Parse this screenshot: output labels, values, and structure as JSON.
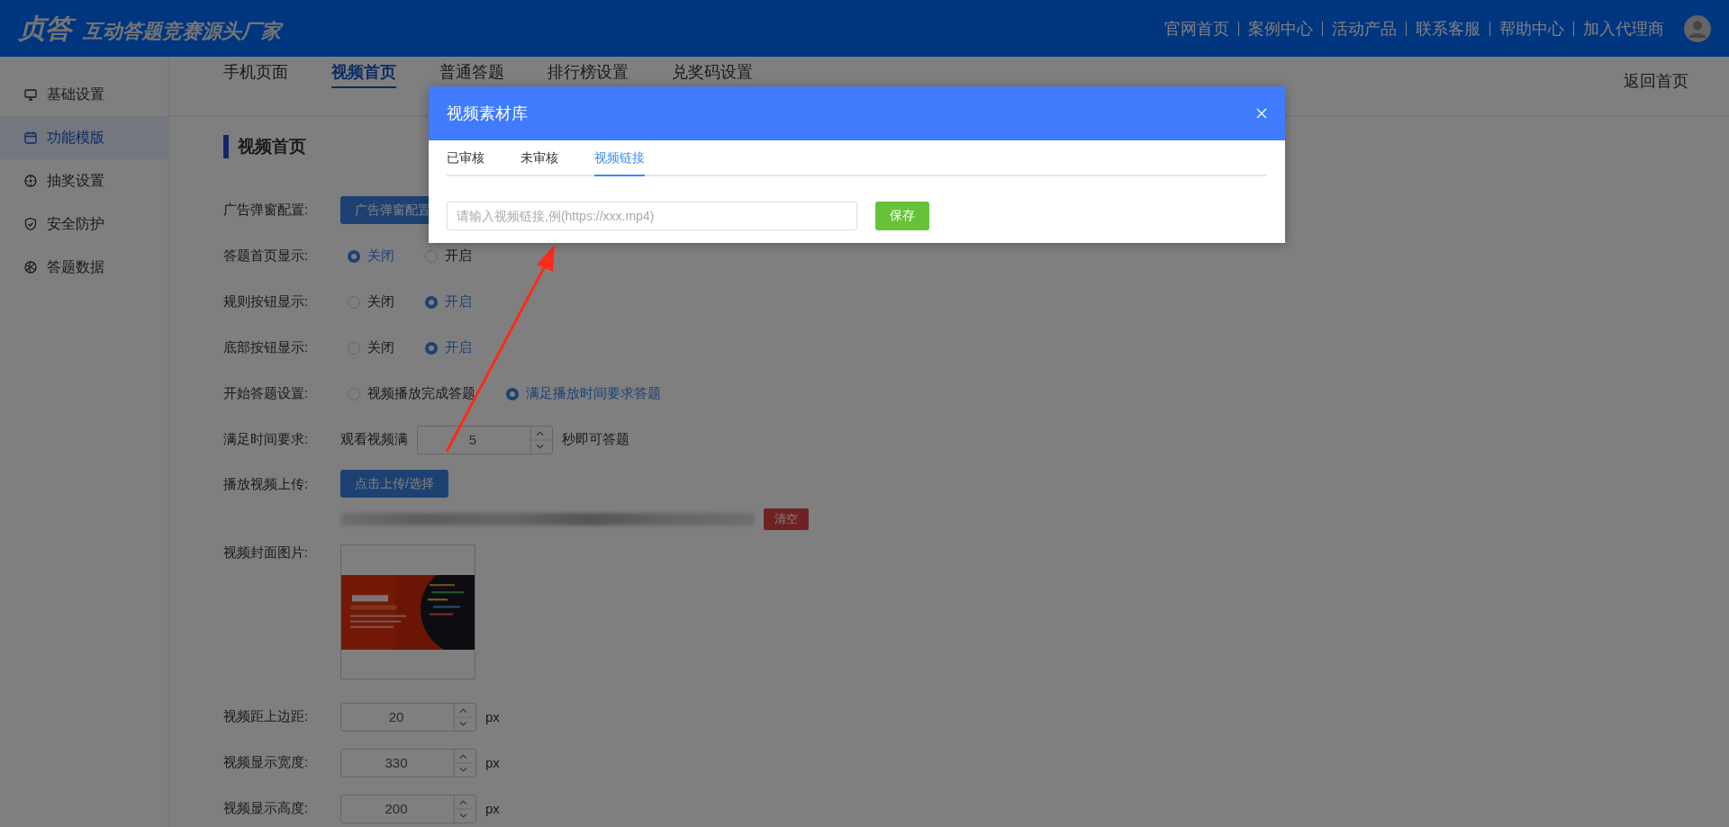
{
  "header": {
    "logo_mark": "贞答",
    "slogan": "互动答题竞赛源头厂家",
    "nav": [
      "官网首页",
      "案例中心",
      "活动产品",
      "联系客服",
      "帮助中心",
      "加入代理商"
    ]
  },
  "sidebar": {
    "items": [
      {
        "label": "基础设置",
        "selected": false
      },
      {
        "label": "功能模版",
        "selected": true
      },
      {
        "label": "抽奖设置",
        "selected": false
      },
      {
        "label": "安全防护",
        "selected": false
      },
      {
        "label": "答题数据",
        "selected": false
      }
    ]
  },
  "tabs": [
    {
      "label": "手机页面",
      "selected": false
    },
    {
      "label": "视频首页",
      "selected": true
    },
    {
      "label": "普通答题",
      "selected": false
    },
    {
      "label": "排行榜设置",
      "selected": false
    },
    {
      "label": "兑奖码设置",
      "selected": false
    }
  ],
  "back_link": "返回首页",
  "section_title": "视频首页",
  "form": {
    "rows": [
      {
        "kind": "button",
        "label": "广告弹窗配置:",
        "button": "广告弹窗配置"
      },
      {
        "kind": "radio",
        "label": "答题首页显示:",
        "options": [
          {
            "label": "关闭",
            "selected": true
          },
          {
            "label": "开启",
            "selected": false
          }
        ]
      },
      {
        "kind": "radio",
        "label": "规则按钮显示:",
        "options": [
          {
            "label": "关闭",
            "selected": false
          },
          {
            "label": "开启",
            "selected": true
          }
        ]
      },
      {
        "kind": "radio",
        "label": "底部按钮显示:",
        "options": [
          {
            "label": "关闭",
            "selected": false
          },
          {
            "label": "开启",
            "selected": true
          }
        ]
      },
      {
        "kind": "radio",
        "label": "开始答题设置:",
        "options": [
          {
            "label": "视频播放完成答题",
            "selected": false
          },
          {
            "label": "满足播放时间要求答题",
            "selected": true
          }
        ]
      },
      {
        "kind": "number",
        "label": "满足时间要求:",
        "prefix": "观看视频满",
        "value": "5",
        "suffix": "秒即可答题"
      },
      {
        "kind": "upload",
        "label": "播放视频上传:",
        "button": "点击上传/选择",
        "clear": "清空"
      },
      {
        "label": "视频封面图片:"
      },
      {
        "kind": "number",
        "label": "视频距上边距:",
        "value": "20",
        "suffix": "px"
      },
      {
        "kind": "number",
        "label": "视频显示宽度:",
        "value": "330",
        "suffix": "px"
      },
      {
        "kind": "number",
        "label": "视频显示高度:",
        "value": "200",
        "suffix": "px"
      }
    ]
  },
  "modal": {
    "title": "视频素材库",
    "tabs": [
      {
        "label": "已审核",
        "selected": false
      },
      {
        "label": "未审核",
        "selected": false
      },
      {
        "label": "视频链接",
        "selected": true
      }
    ],
    "input": {
      "placeholder": "请输入视频链接,例(https://xxx.mp4)"
    },
    "save": "保存"
  }
}
